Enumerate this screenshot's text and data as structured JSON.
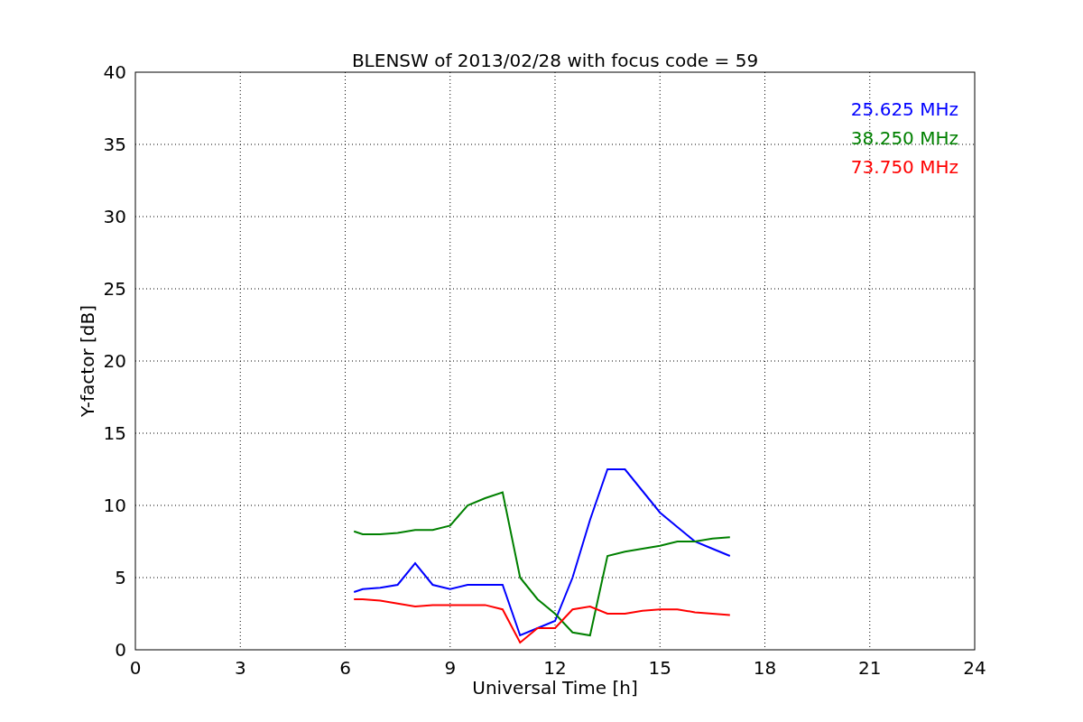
{
  "figure": {
    "chart_data": {
      "type": "line",
      "title": "BLENSW of 2013/02/28 with focus code = 59",
      "xlabel": "Universal Time [h]",
      "ylabel": "Y-factor [dB]",
      "x": [
        6.25,
        6.5,
        7,
        7.5,
        8,
        8.5,
        9,
        9.5,
        10,
        10.5,
        11,
        11.5,
        12,
        12.5,
        13,
        13.5,
        14,
        14.5,
        15,
        15.5,
        16,
        16.5,
        17
      ],
      "series": [
        {
          "name": "25.625 MHz",
          "color": "#0000ff",
          "values": [
            4,
            4.2,
            4.3,
            4.5,
            6,
            4.5,
            4.2,
            4.5,
            4.5,
            4.5,
            1,
            1.5,
            2,
            5,
            9,
            12.5,
            12.5,
            11,
            9.5,
            8.5,
            7.5,
            7,
            6.5
          ]
        },
        {
          "name": "38.250 MHz",
          "color": "#008000",
          "values": [
            8.2,
            8,
            8,
            8.1,
            8.3,
            8.3,
            8.6,
            10,
            10.5,
            10.9,
            5,
            3.5,
            2.5,
            1.2,
            1,
            6.5,
            6.8,
            7,
            7.2,
            7.5,
            7.5,
            7.7,
            7.8
          ]
        },
        {
          "name": "73.750 MHz",
          "color": "#ff0000",
          "values": [
            3.5,
            3.5,
            3.4,
            3.2,
            3,
            3.1,
            3.1,
            3.1,
            3.1,
            2.8,
            0.5,
            1.5,
            1.5,
            2.8,
            3,
            2.5,
            2.5,
            2.7,
            2.8,
            2.8,
            2.6,
            2.5,
            2.4
          ]
        }
      ],
      "grid": true,
      "xlim": [
        0,
        24
      ],
      "ylim": [
        0,
        40
      ],
      "xticks": [
        0,
        3,
        6,
        9,
        12,
        15,
        18,
        21,
        24
      ],
      "yticks": [
        0,
        5,
        10,
        15,
        20,
        25,
        30,
        35,
        40
      ]
    }
  }
}
